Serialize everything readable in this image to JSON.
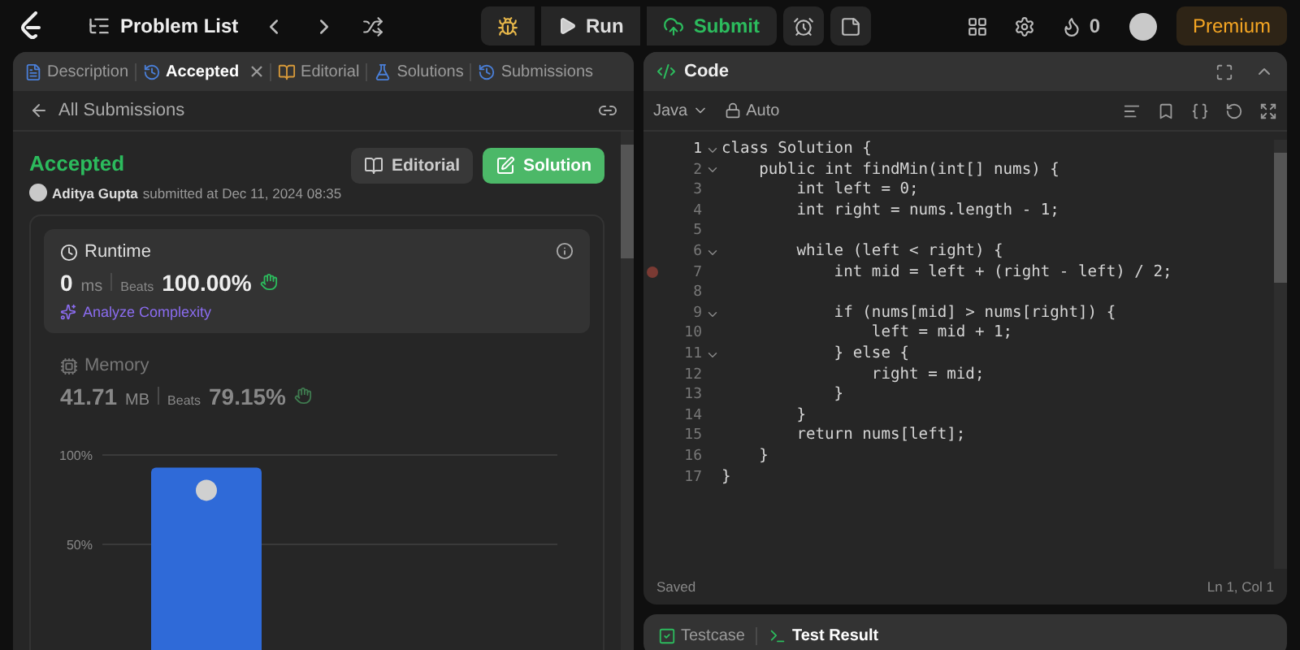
{
  "topbar": {
    "nav_label": "Problem List",
    "run_label": "Run",
    "submit_label": "Submit",
    "streak": "0",
    "premium": "Premium"
  },
  "left": {
    "tabs": [
      {
        "label": "Description",
        "selected": false,
        "closable": false
      },
      {
        "label": "Accepted",
        "selected": true,
        "closable": true
      },
      {
        "label": "Editorial",
        "selected": false,
        "closable": false
      },
      {
        "label": "Solutions",
        "selected": false,
        "closable": false
      },
      {
        "label": "Submissions",
        "selected": false,
        "closable": false
      }
    ],
    "back_label": "All Submissions",
    "status": "Accepted",
    "author": "Aditya Gupta",
    "submitted": "submitted at Dec 11, 2024 08:35",
    "buttons": [
      {
        "label": "Editorial",
        "kind": "secondary"
      },
      {
        "label": "Solution",
        "kind": "primary"
      }
    ],
    "metrics": [
      {
        "kind": "runtime",
        "label": "Runtime",
        "value": "0",
        "unit": "ms",
        "beats_label": "Beats",
        "beats": "100.00%",
        "selected": true,
        "link": "Analyze Complexity"
      },
      {
        "kind": "memory",
        "label": "Memory",
        "value": "41.71",
        "unit": "MB",
        "beats_label": "Beats",
        "beats": "79.15%",
        "selected": false
      }
    ],
    "chart_data": {
      "type": "bar",
      "values": [
        93
      ],
      "ylim": [
        0,
        100
      ],
      "yticks": [
        {
          "value": 50,
          "label": "50%"
        },
        {
          "value": 100,
          "label": "100%"
        }
      ]
    }
  },
  "editor": {
    "title": "Code",
    "language": "Java",
    "mode": "Auto",
    "status": "Saved",
    "cursor": "Ln 1, Col 1",
    "lines": [
      {
        "number": "1",
        "foldable": true,
        "current": true,
        "breakpoint": false,
        "code": "class Solution {"
      },
      {
        "number": "2",
        "foldable": true,
        "current": false,
        "breakpoint": false,
        "code": "    public int findMin(int[] nums) {"
      },
      {
        "number": "3",
        "foldable": false,
        "current": false,
        "breakpoint": false,
        "code": "        int left = 0;"
      },
      {
        "number": "4",
        "foldable": false,
        "current": false,
        "breakpoint": false,
        "code": "        int right = nums.length - 1;"
      },
      {
        "number": "5",
        "foldable": false,
        "current": false,
        "breakpoint": false
      },
      {
        "number": "6",
        "foldable": true,
        "current": false,
        "breakpoint": false,
        "code": "        while (left < right) {"
      },
      {
        "number": "7",
        "foldable": false,
        "current": false,
        "breakpoint": true,
        "code": "            int mid = left + (right - left) / 2;"
      },
      {
        "number": "8",
        "foldable": false,
        "current": false,
        "breakpoint": false
      },
      {
        "number": "9",
        "foldable": true,
        "current": false,
        "breakpoint": false,
        "code": "            if (nums[mid] > nums[right]) {"
      },
      {
        "number": "10",
        "foldable": false,
        "current": false,
        "breakpoint": false,
        "code": "                left = mid + 1;"
      },
      {
        "number": "11",
        "foldable": true,
        "current": false,
        "breakpoint": false,
        "code": "            } else {"
      },
      {
        "number": "12",
        "foldable": false,
        "current": false,
        "breakpoint": false,
        "code": "                right = mid;"
      },
      {
        "number": "13",
        "foldable": false,
        "current": false,
        "breakpoint": false,
        "code": "            }"
      },
      {
        "number": "14",
        "foldable": false,
        "current": false,
        "breakpoint": false,
        "code": "        }"
      },
      {
        "number": "15",
        "foldable": false,
        "current": false,
        "breakpoint": false,
        "code": "        return nums[left];"
      },
      {
        "number": "16",
        "foldable": false,
        "current": false,
        "breakpoint": false,
        "code": "    }"
      },
      {
        "number": "17",
        "foldable": false,
        "current": false,
        "breakpoint": false,
        "code": "}"
      }
    ]
  },
  "bottom": {
    "tabs": [
      {
        "label": "Testcase",
        "selected": false
      },
      {
        "label": "Test Result",
        "selected": true
      }
    ]
  }
}
